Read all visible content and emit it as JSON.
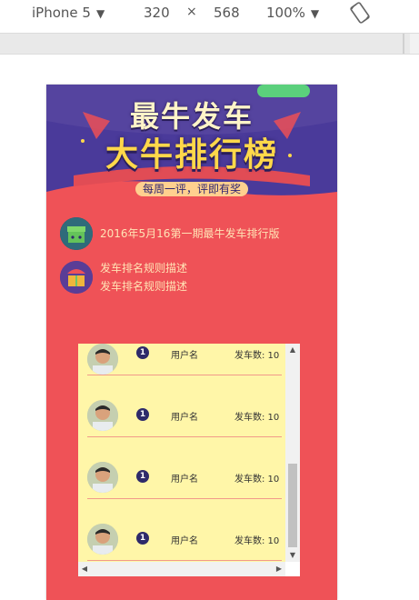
{
  "toolbar": {
    "device": "iPhone 5",
    "width": "320",
    "times": "×",
    "height": "568",
    "zoom": "100%",
    "dropdown_arrow": "▼",
    "rotate_icon": "rotate-icon"
  },
  "banner": {
    "title_line1": "最牛发车",
    "title_line2": "大牛排行榜",
    "subtitle": "每周一评，评即有奖"
  },
  "info": {
    "line1": "2016年5月16第一期最牛发车排行版",
    "rules": [
      "发车排名规则描述",
      "发车排名规则描述"
    ]
  },
  "ranking": {
    "items": [
      {
        "rank": "1",
        "username": "用户名",
        "count": "发车数: 10"
      },
      {
        "rank": "1",
        "username": "用户名",
        "count": "发车数: 10"
      },
      {
        "rank": "1",
        "username": "用户名",
        "count": "发车数: 10"
      },
      {
        "rank": "1",
        "username": "用户名",
        "count": "发车数: 10"
      }
    ]
  },
  "scrollbar": {
    "up": "▲",
    "down": "▼",
    "left": "◀",
    "right": "▶"
  },
  "colors": {
    "page_red": "#ef5257",
    "banner_purple": "#4a3a9a",
    "list_yellow": "#fff6a8",
    "rank_badge": "#2e2a6a",
    "info_text": "#ffe3b5"
  }
}
